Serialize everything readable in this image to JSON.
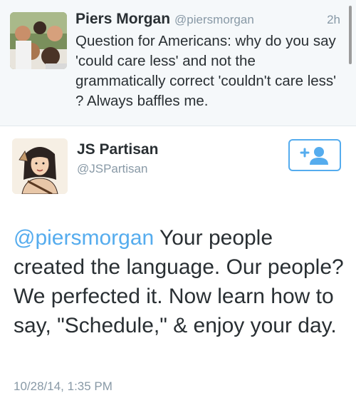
{
  "parent_tweet": {
    "name": "Piers Morgan",
    "handle": "@piersmorgan",
    "time": "2h",
    "text": "Question for Americans: why do you say 'could care less' and not the grammatically correct 'couldn't care less' ? Always baffles me.",
    "avatar_icon": "group-photo-avatar"
  },
  "tweet": {
    "name": "JS Partisan",
    "handle": "@JSPartisan",
    "avatar_icon": "illustrated-woman-avatar",
    "follow_icon": "add-user-icon",
    "mention": "@piersmorgan",
    "text": " Your people created the language.  Our people?  We perfected it.  Now learn how to say, \"Schedule,\" & enjoy your day.",
    "timestamp": "10/28/14, 1:35 PM"
  },
  "colors": {
    "accent": "#55acee",
    "muted": "#8899a6",
    "text": "#292f33",
    "parent_bg": "#f5f8fa"
  }
}
